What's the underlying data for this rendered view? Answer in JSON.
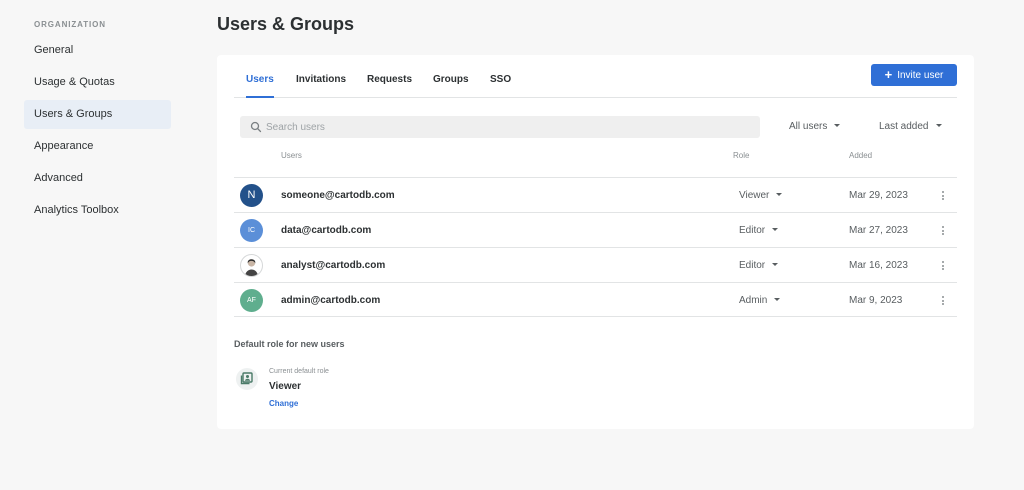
{
  "sidebar": {
    "heading": "ORGANIZATION",
    "items": [
      {
        "label": "General"
      },
      {
        "label": "Usage & Quotas"
      },
      {
        "label": "Users & Groups"
      },
      {
        "label": "Appearance"
      },
      {
        "label": "Advanced"
      },
      {
        "label": "Analytics Toolbox"
      }
    ],
    "active_index": 2
  },
  "page": {
    "title": "Users & Groups"
  },
  "tabs": [
    {
      "label": "Users"
    },
    {
      "label": "Invitations"
    },
    {
      "label": "Requests"
    },
    {
      "label": "Groups"
    },
    {
      "label": "SSO"
    }
  ],
  "active_tab": "Users",
  "invite_button": {
    "label": "Invite user",
    "icon": "plus-icon"
  },
  "search": {
    "placeholder": "Search users",
    "value": ""
  },
  "filters": {
    "users_filter": "All users",
    "sort": "Last added"
  },
  "table": {
    "headers": {
      "users": "Users",
      "role": "Role",
      "added": "Added"
    },
    "rows": [
      {
        "avatar": "N",
        "avatar_color": "#23518a",
        "email": "someone@cartodb.com",
        "role": "Viewer",
        "added": "Mar 29, 2023"
      },
      {
        "avatar": "IC",
        "avatar_color": "#5b8fd8",
        "email": "data@cartodb.com",
        "role": "Editor",
        "added": "Mar 27, 2023"
      },
      {
        "avatar": "",
        "avatar_color": "#ffffff",
        "email": "analyst@cartodb.com",
        "role": "Editor",
        "added": "Mar 16, 2023"
      },
      {
        "avatar": "AF",
        "avatar_color": "#5fae8e",
        "email": "admin@cartodb.com",
        "role": "Admin",
        "added": "Mar 9, 2023"
      }
    ]
  },
  "default_role": {
    "title": "Default role for new users",
    "current_label": "Current default role",
    "value": "Viewer",
    "change_label": "Change"
  },
  "colors": {
    "accent": "#2f6fd6",
    "sidebar_active": "#e8eef6",
    "background": "#f7f7f7",
    "card": "#ffffff"
  }
}
